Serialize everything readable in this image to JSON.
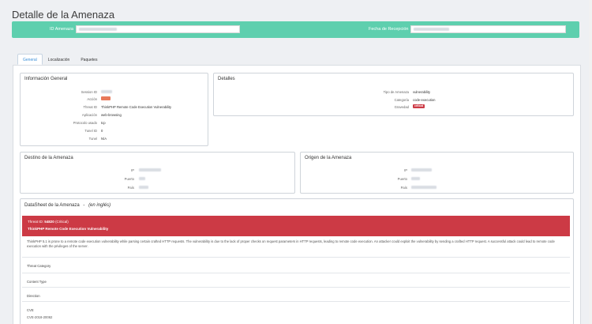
{
  "page": {
    "title": "Detalle de la Amenaza"
  },
  "id_bar": {
    "id_label": "ID Amenaza",
    "id_value": "",
    "date_label": "Fecha de Recepción",
    "date_value": "",
    "bg_color": "#5ecfae"
  },
  "tabs": [
    {
      "label": "General",
      "active": true
    },
    {
      "label": "Localización",
      "active": false
    },
    {
      "label": "Paquetes",
      "active": false
    }
  ],
  "info_general": {
    "title": "Información General",
    "rows": [
      {
        "label": "Session ID",
        "value": ""
      },
      {
        "label": "Acción",
        "value": ""
      },
      {
        "label": "Threat ID",
        "value": "ThinkPHP Remote Code Execution Vulnerability"
      },
      {
        "label": "Aplicación",
        "value": "web-browsing"
      },
      {
        "label": "Protocolo usado",
        "value": "tcp"
      },
      {
        "label": "Tunel ID",
        "value": "0"
      },
      {
        "label": "Tunel",
        "value": "N/A"
      }
    ]
  },
  "detalles": {
    "title": "Detalles",
    "rows": [
      {
        "label": "Tipo de Amenaza",
        "value": "vulnerability"
      },
      {
        "label": "Categoría",
        "value": "code-execution"
      },
      {
        "label": "Gravedad",
        "value": "critical"
      }
    ],
    "severity_color": "#cc3a45"
  },
  "destino": {
    "title": "Destino de la Amenaza",
    "rows": [
      {
        "label": "IP",
        "value": ""
      },
      {
        "label": "Puerto",
        "value": ""
      },
      {
        "label": "País",
        "value": ""
      }
    ]
  },
  "origen": {
    "title": "Origen de la Amenaza",
    "rows": [
      {
        "label": "IP",
        "value": ""
      },
      {
        "label": "Puerto",
        "value": ""
      },
      {
        "label": "País",
        "value": ""
      }
    ]
  },
  "datasheet": {
    "title": "DataSheet de la Amenaza",
    "subtitle": "(en inglés)",
    "separator": "-",
    "header_line1_prefix": "Threat ID:",
    "header_id": "54820",
    "header_severity": "(Critical)",
    "header_name": "ThinkPHP Remote Code Execution Vulnerability",
    "header_color": "#cc3a45",
    "description": "ThinkPHP 5.1 is prone to a remote code execution vulnerability while parsing certain crafted HTTP requests. The vulnerability is due to the lack of proper checks on request parameters in HTTP requests, leading to remote code execution. An attacker could exploit the vulnerability by sending a crafted HTTP request. A successful attack could lead to remote code execution with the privileges of the server.",
    "rows": [
      {
        "label": "Threat Category"
      },
      {
        "label": "Content Type"
      },
      {
        "label": "Direction"
      },
      {
        "label": "CVE",
        "value": "CVE-2018-20062"
      }
    ]
  }
}
